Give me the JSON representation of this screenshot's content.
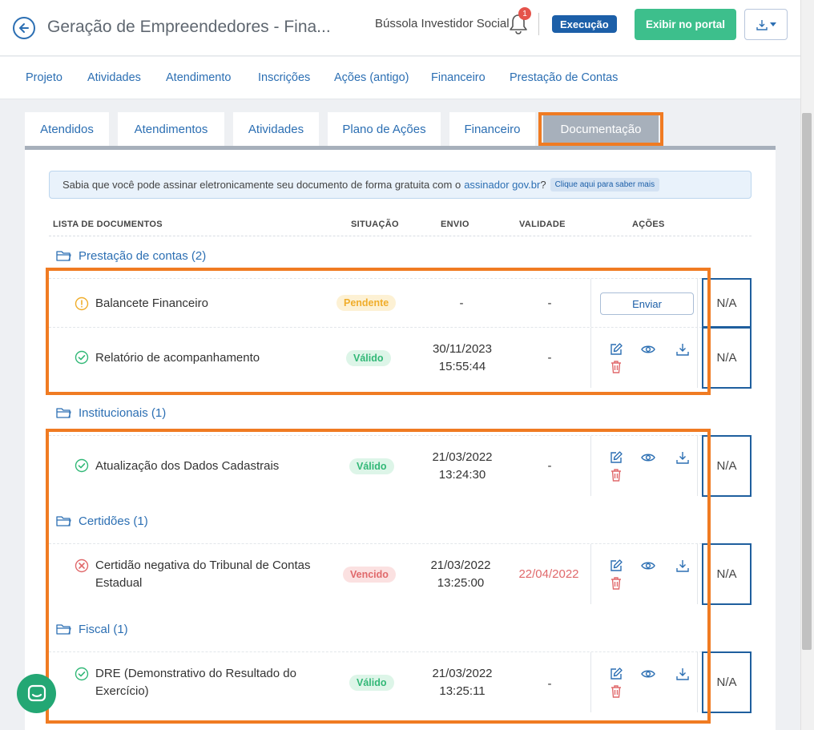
{
  "header": {
    "title": "Geração de Empreendedores - Fina...",
    "org": "Bússola Investidor Social",
    "notification_count": "1",
    "status": "Execução",
    "portal_label": "Exibir no portal"
  },
  "nav": [
    "Projeto",
    "Atividades",
    "Atendimento",
    "Inscrições",
    "Ações (antigo)",
    "Financeiro",
    "Prestação de Contas"
  ],
  "tabs": [
    "Atendidos",
    "Atendimentos",
    "Atividades",
    "Plano de Ações",
    "Financeiro",
    "Documentação"
  ],
  "active_tab": "Documentação",
  "info": {
    "text": "Sabia que você pode assinar eletronicamente seu documento de forma gratuita com o",
    "link": "assinador gov.br",
    "mark": "?",
    "cta": "Clique aqui para saber mais"
  },
  "columns": {
    "list": "LISTA DE DOCUMENTOS",
    "status": "SITUAÇÃO",
    "sent": "ENVIO",
    "validity": "VALIDADE",
    "actions": "AÇÕES"
  },
  "groups": [
    {
      "name": "Prestação de contas (2)",
      "documents": [
        {
          "name": "Balancete Financeiro",
          "status": "Pendente",
          "sent": "-",
          "sent_time": "",
          "validity": "-",
          "action": "Enviar",
          "na": "N/A"
        },
        {
          "name": "Relatório de acompanhamento",
          "status": "Válido",
          "sent": "30/11/2023",
          "sent_time": "15:55:44",
          "validity": "-",
          "na": "N/A"
        }
      ]
    },
    {
      "name": "Institucionais (1)",
      "documents": [
        {
          "name": "Atualização dos Dados Cadastrais",
          "status": "Válido",
          "sent": "21/03/2022",
          "sent_time": "13:24:30",
          "validity": "-",
          "na": "N/A"
        }
      ]
    },
    {
      "name": "Certidões (1)",
      "documents": [
        {
          "name": "Certidão negativa do Tribunal de Contas Estadual",
          "status": "Vencido",
          "sent": "21/03/2022",
          "sent_time": "13:25:00",
          "validity": "22/04/2022",
          "na": "N/A"
        }
      ]
    },
    {
      "name": "Fiscal (1)",
      "documents": [
        {
          "name": "DRE (Demonstrativo do Resultado do Exercício)",
          "status": "Válido",
          "sent": "21/03/2022",
          "sent_time": "13:25:11",
          "validity": "-",
          "na": "N/A"
        }
      ]
    }
  ],
  "colors": {
    "primary": "#2c6fb3",
    "success": "#3dbf8c",
    "highlight": "#f07b22",
    "status_blue": "#1c5fa8"
  },
  "icons": [
    "back-arrow-icon",
    "bell-icon",
    "download-icon",
    "folder-icon",
    "warning-icon",
    "check-circle-icon",
    "x-circle-icon",
    "edit-icon",
    "eye-icon",
    "trash-icon",
    "chat-icon"
  ]
}
